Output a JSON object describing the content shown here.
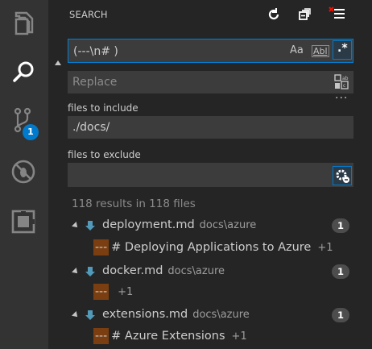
{
  "activity_bar": {
    "items": [
      {
        "name": "explorer",
        "icon": "files-icon"
      },
      {
        "name": "search",
        "icon": "search-icon",
        "active": true
      },
      {
        "name": "source-control",
        "icon": "source-control-icon",
        "badge": "1"
      },
      {
        "name": "debug",
        "icon": "debug-disabled-icon"
      },
      {
        "name": "extensions",
        "icon": "extensions-icon"
      }
    ]
  },
  "sidebar": {
    "title": "SEARCH",
    "search": {
      "value": "(---\\n# )",
      "options": {
        "match_case": "Aa",
        "whole_word": "Abl",
        "regex": ".*"
      }
    },
    "replace": {
      "placeholder": "Replace"
    },
    "include": {
      "label": "files to include",
      "value": "./docs/"
    },
    "exclude": {
      "label": "files to exclude",
      "value": ""
    },
    "more": "···",
    "summary": "118 results in 118 files",
    "results": [
      {
        "file": "deployment.md",
        "path": "docs\\azure",
        "count": "1",
        "match": {
          "highlight": "---",
          "text": "# Deploying Applications to Azure",
          "plus": "+1"
        }
      },
      {
        "file": "docker.md",
        "path": "docs\\azure",
        "count": "1",
        "match": {
          "highlight": "---",
          "text": "",
          "plus": "+1"
        }
      },
      {
        "file": "extensions.md",
        "path": "docs\\azure",
        "count": "1",
        "match": {
          "highlight": "---",
          "text": "# Azure Extensions",
          "plus": "+1"
        }
      }
    ]
  },
  "colors": {
    "accent": "#007acc",
    "match_highlight": "#7a3e10",
    "background": "#252526",
    "activity_bar": "#333333"
  }
}
